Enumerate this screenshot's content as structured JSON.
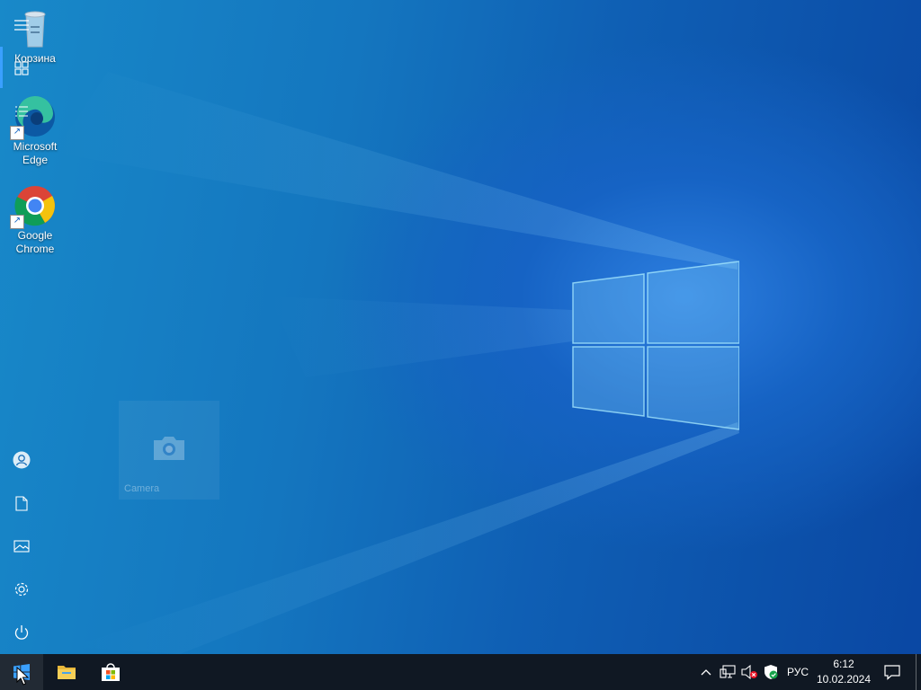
{
  "desktop": {
    "icons": [
      {
        "label": "Корзина",
        "icon": "recycle-bin-icon"
      },
      {
        "label": "Microsoft Edge",
        "icon": "edge-icon"
      },
      {
        "label": "Google Chrome",
        "icon": "chrome-icon"
      }
    ]
  },
  "start_menu": {
    "rail": [
      {
        "icon": "hamburger-icon"
      },
      {
        "icon": "tiles-icon"
      },
      {
        "icon": "all-apps-icon"
      },
      {
        "icon": "user-icon"
      },
      {
        "icon": "documents-icon"
      },
      {
        "icon": "pictures-icon"
      },
      {
        "icon": "settings-icon"
      },
      {
        "icon": "power-icon"
      }
    ],
    "tile": {
      "label": "Camera",
      "icon": "camera-icon"
    }
  },
  "taskbar": {
    "pinned": [
      {
        "icon": "start-windows-icon"
      },
      {
        "icon": "file-explorer-icon"
      },
      {
        "icon": "microsoft-store-icon"
      }
    ],
    "tray": {
      "language": "РУС",
      "time": "6:12",
      "date": "10.02.2024",
      "icons": [
        "chevron-up-icon",
        "network-icon",
        "volume-muted-icon",
        "security-icon",
        "notification-icon"
      ]
    }
  },
  "colors": {
    "accent": "#3aa0ff",
    "taskbar": "#101823",
    "wallpaper": "#1476bf"
  }
}
